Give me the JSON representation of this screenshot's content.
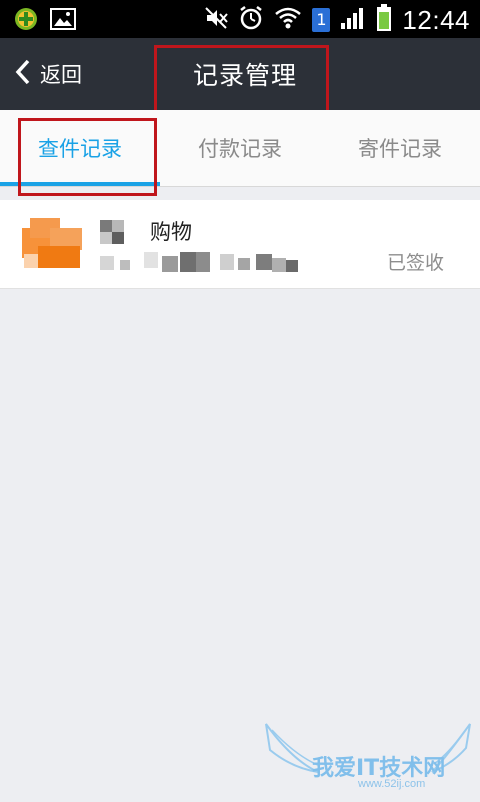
{
  "status_bar": {
    "time": "12:44",
    "sim_slot": "1",
    "icons": [
      "app-plus-icon",
      "gallery-icon",
      "mute-icon",
      "alarm-icon",
      "wifi-icon",
      "signal-icon",
      "battery-icon"
    ]
  },
  "nav": {
    "back_label": "返回",
    "title": "记录管理"
  },
  "tabs": [
    {
      "label": "查件记录",
      "active": true
    },
    {
      "label": "付款记录",
      "active": false
    },
    {
      "label": "寄件记录",
      "active": false
    }
  ],
  "records": [
    {
      "title": "购物",
      "status": "已签收"
    }
  ],
  "watermark": {
    "text": "我爱IT技术网",
    "url": "www.52ij.com"
  },
  "colors": {
    "accent": "#1aa2e6",
    "navbar": "#2c3038",
    "highlight_box": "#c0161c",
    "background": "#edeef2"
  }
}
